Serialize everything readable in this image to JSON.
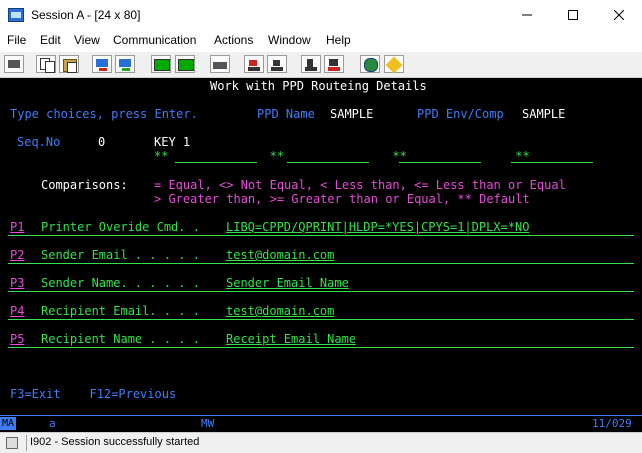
{
  "window": {
    "title": "Session A - [24 x 80]"
  },
  "menu": [
    "File",
    "Edit",
    "View",
    "Communication",
    "Actions",
    "Window",
    "Help"
  ],
  "screen": {
    "title": "Work with PPD Routeing Details",
    "instructions": "Type choices, press Enter.",
    "ppd_name_label": "PPD Name",
    "ppd_name_value": "SAMPLE",
    "ppd_env_label": "PPD Env/Comp",
    "ppd_env_value": "SAMPLE",
    "seq_label": "Seq.No",
    "seq_value": "0",
    "key_label": "KEY 1",
    "key_fields": "**              **               **               **",
    "comparisons_label": "Comparisons:",
    "comparisons_line1": "= Equal, <> Not Equal, < Less than, <= Less than or Equal",
    "comparisons_line2": "> Greater than, >= Greater than or Equal, ** Default",
    "fields": [
      {
        "key": "P1",
        "label": "Printer Overide Cmd. .",
        "value": "LIBQ=CPPD/QPRINT|HLDP=*YES|CPYS=1|DPLX=*NO"
      },
      {
        "key": "P2",
        "label": "Sender Email . . . . .",
        "value": "test@domain.com"
      },
      {
        "key": "P3",
        "label": "Sender Name. . . . . .",
        "value": "Sender Email Name"
      },
      {
        "key": "P4",
        "label": "Recipient Email. . . .",
        "value": "test@domain.com"
      },
      {
        "key": "P5",
        "label": "Recipient Name . . . .",
        "value": "Receipt Email Name"
      }
    ],
    "function_keys": "F3=Exit    F12=Previous"
  },
  "oia": {
    "ma": "MA",
    "indicator": "a",
    "mode": "MW",
    "position": "11/029"
  },
  "status": {
    "message": "I902 - Session successfully started"
  },
  "colors": {
    "green": "#35e04a",
    "blue": "#3f7df6",
    "pink": "#e64cd6",
    "white": "#ffffff",
    "background": "#000000"
  }
}
